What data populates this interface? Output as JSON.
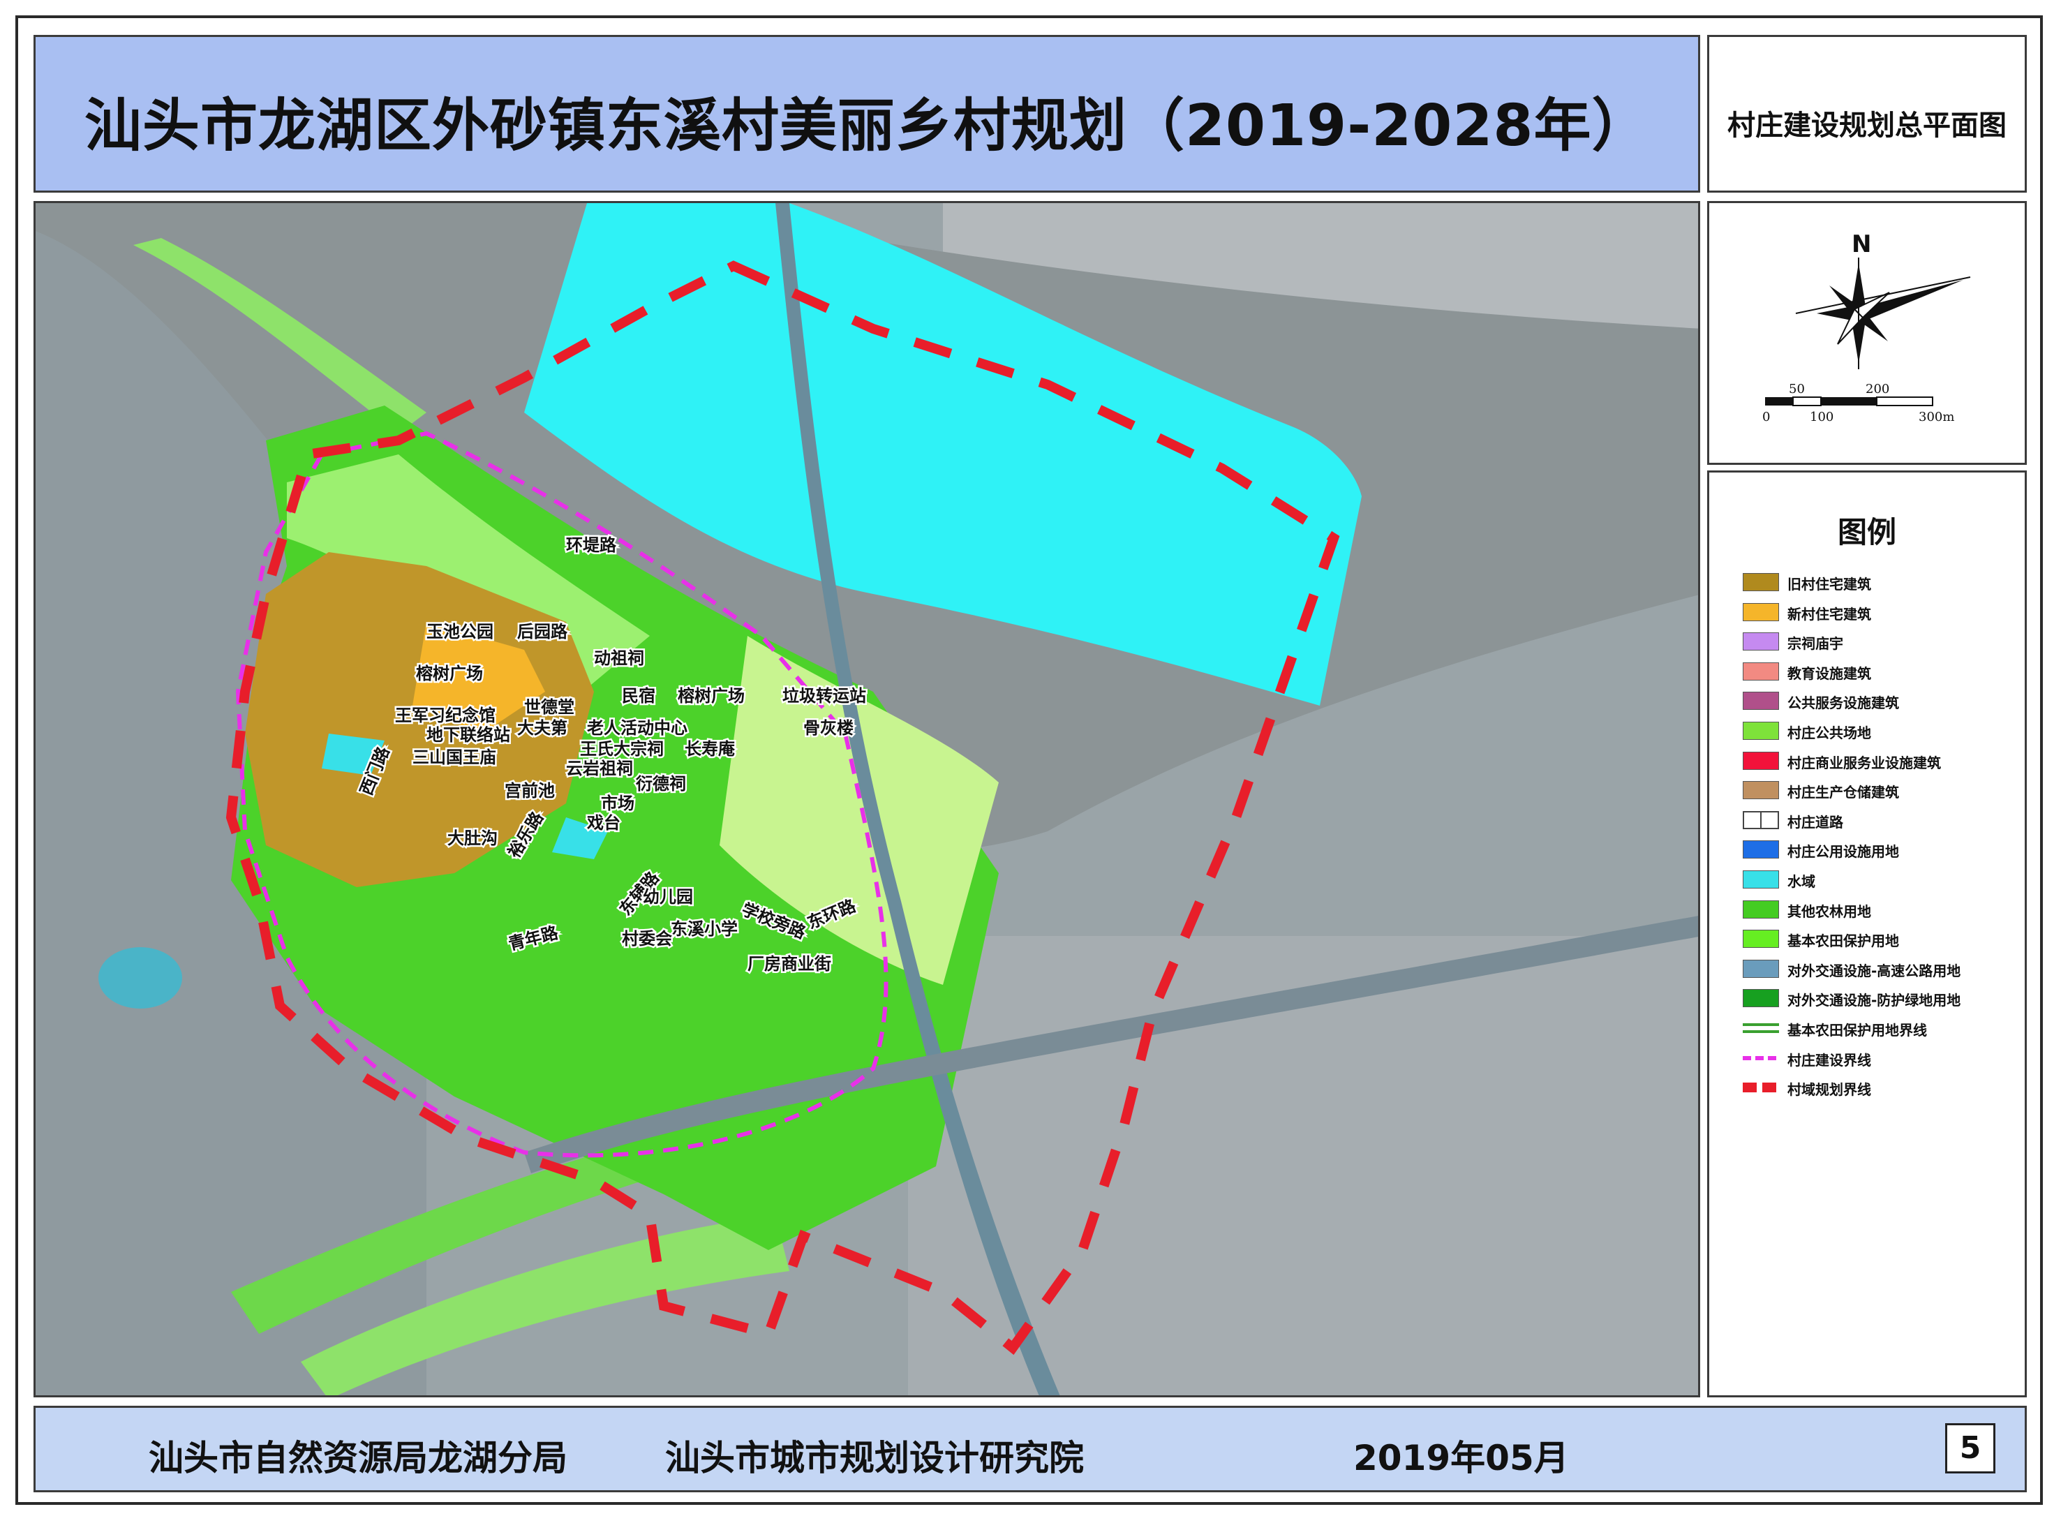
{
  "title": "汕头市龙湖区外砂镇东溪村美丽乡村规划（2019-2028年）",
  "subtitle": "村庄建设规划总平面图",
  "compass": {
    "north_label": "N",
    "scale_top": [
      "50",
      "200"
    ],
    "scale_bottom": [
      "0",
      "100",
      "300m"
    ]
  },
  "legend": {
    "title": "图例",
    "items": [
      {
        "label": "旧村住宅建筑",
        "color": "#b08a1e",
        "style": "fill"
      },
      {
        "label": "新村住宅建筑",
        "color": "#f5b52a",
        "style": "fill"
      },
      {
        "label": "宗祠庙宇",
        "color": "#c58af0",
        "style": "fill"
      },
      {
        "label": "教育设施建筑",
        "color": "#f28a82",
        "style": "fill"
      },
      {
        "label": "公共服务设施建筑",
        "color": "#b0508a",
        "style": "fill"
      },
      {
        "label": "村庄公共场地",
        "color": "#7ee23a",
        "style": "fill"
      },
      {
        "label": "村庄商业服务业设施建筑",
        "color": "#f2123a",
        "style": "fill"
      },
      {
        "label": "村庄生产仓储建筑",
        "color": "#c09060",
        "style": "fill"
      },
      {
        "label": "村庄道路",
        "color": "#ffffff",
        "style": "road"
      },
      {
        "label": "村庄公用设施用地",
        "color": "#1e6ee6",
        "style": "fill"
      },
      {
        "label": "水域",
        "color": "#38e0e8",
        "style": "fill"
      },
      {
        "label": "其他农林用地",
        "color": "#44cc22",
        "style": "fill"
      },
      {
        "label": "基本农田保护用地",
        "color": "#66ee22",
        "style": "fill"
      },
      {
        "label": "对外交通设施-高速公路用地",
        "color": "#6a9cbc",
        "style": "fill"
      },
      {
        "label": "对外交通设施-防护绿地用地",
        "color": "#17a020",
        "style": "fill"
      },
      {
        "label": "基本农田保护用地界线",
        "color": "#3aa030",
        "style": "line"
      },
      {
        "label": "村庄建设界线",
        "color": "#e830e8",
        "style": "dashed"
      },
      {
        "label": "村域规划界线",
        "color": "#e81e2a",
        "style": "bigdash"
      }
    ]
  },
  "map_labels": [
    "环堤路",
    "玉池公园",
    "后园路",
    "动祖祠",
    "榕树广场",
    "民宿",
    "榕树广场",
    "垃圾转运站",
    "王军习纪念馆",
    "世德堂",
    "大夫第",
    "老人活动中心",
    "骨灰楼",
    "地下联络站",
    "王氏大宗祠",
    "长寿庵",
    "三山国王庙",
    "云岩祖祠",
    "衍德祠",
    "西门路",
    "宫前池",
    "市场",
    "戏台",
    "大肚沟",
    "裕乐路",
    "东辅路",
    "幼儿园",
    "学校旁路",
    "东环路",
    "东溪小学",
    "村委会",
    "青年路",
    "厂房商业街"
  ],
  "footer": {
    "org1": "汕头市自然资源局龙湖分局",
    "org2": "汕头市城市规划设计研究院",
    "date": "2019年05月",
    "page": "5"
  }
}
